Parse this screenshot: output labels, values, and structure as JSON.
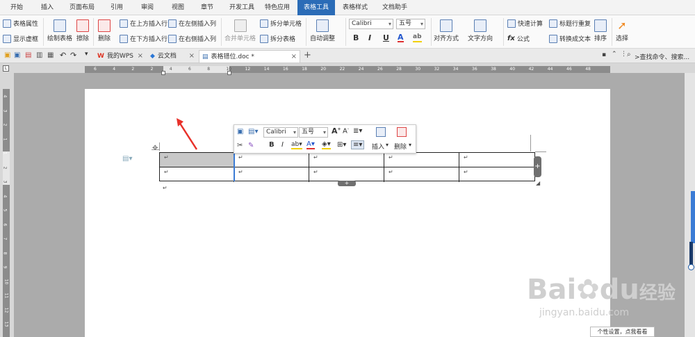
{
  "menu": {
    "tabs": [
      "开始",
      "插入",
      "页面布局",
      "引用",
      "审阅",
      "视图",
      "章节",
      "开发工具",
      "特色应用",
      "表格工具",
      "表格样式",
      "文档助手"
    ],
    "active_tab": "表格工具",
    "active_color": "#2b6cb7"
  },
  "ribbon": {
    "table_props": "表格属性",
    "show_gridlines": "显示虚框",
    "draw_table": "绘制表格",
    "erase": "擦除",
    "delete": "删除",
    "insert_row_above": "在上方插入行",
    "insert_row_below": "在下方插入行",
    "insert_col_left": "在左侧插入列",
    "insert_col_right": "在右侧插入列",
    "merge_cells": "合并单元格",
    "split_cells": "拆分单元格",
    "split_table": "拆分表格",
    "auto_fit": "自动调整",
    "font": "Calibri",
    "size": "五号",
    "bold": "B",
    "italic": "I",
    "underline": "U",
    "align": "对齐方式",
    "text_dir": "文字方向",
    "quick_calc": "快速计算",
    "formula": "公式",
    "repeat_header": "标题行重复",
    "convert_text": "转换成文本",
    "sort": "排序",
    "select": "选择"
  },
  "doc_tabs": {
    "wps": "我的WPS",
    "cloud": "云文档",
    "doc": "表格错位.doc *",
    "search": ">查找命令、搜索..."
  },
  "ruler": {
    "h_ticks": [
      "6",
      "4",
      "2",
      "2",
      "4",
      "6",
      "8",
      "10",
      "12",
      "14",
      "16",
      "18",
      "20",
      "22",
      "24",
      "26",
      "28",
      "30",
      "32",
      "34",
      "36",
      "38",
      "40",
      "42",
      "44",
      "46",
      "48"
    ],
    "v_ticks": [
      "4",
      "3",
      "2",
      "1",
      "1",
      "2",
      "3",
      "4",
      "5",
      "6",
      "7",
      "8",
      "9",
      "10",
      "11",
      "12",
      "13"
    ]
  },
  "float_toolbar": {
    "font": "Calibri",
    "size": "五号",
    "bold": "B",
    "italic": "I",
    "insert": "插入",
    "delete": "删除"
  },
  "table": {
    "rows": 2,
    "cols": 5,
    "mark": "↵",
    "selected_fill": "#c8c8c8"
  },
  "watermark": {
    "brand": "Bai",
    "brand2": "du",
    "brand3": "经验",
    "url": "jingyan.baidu.com"
  },
  "tip": "个性设置，点我看看"
}
